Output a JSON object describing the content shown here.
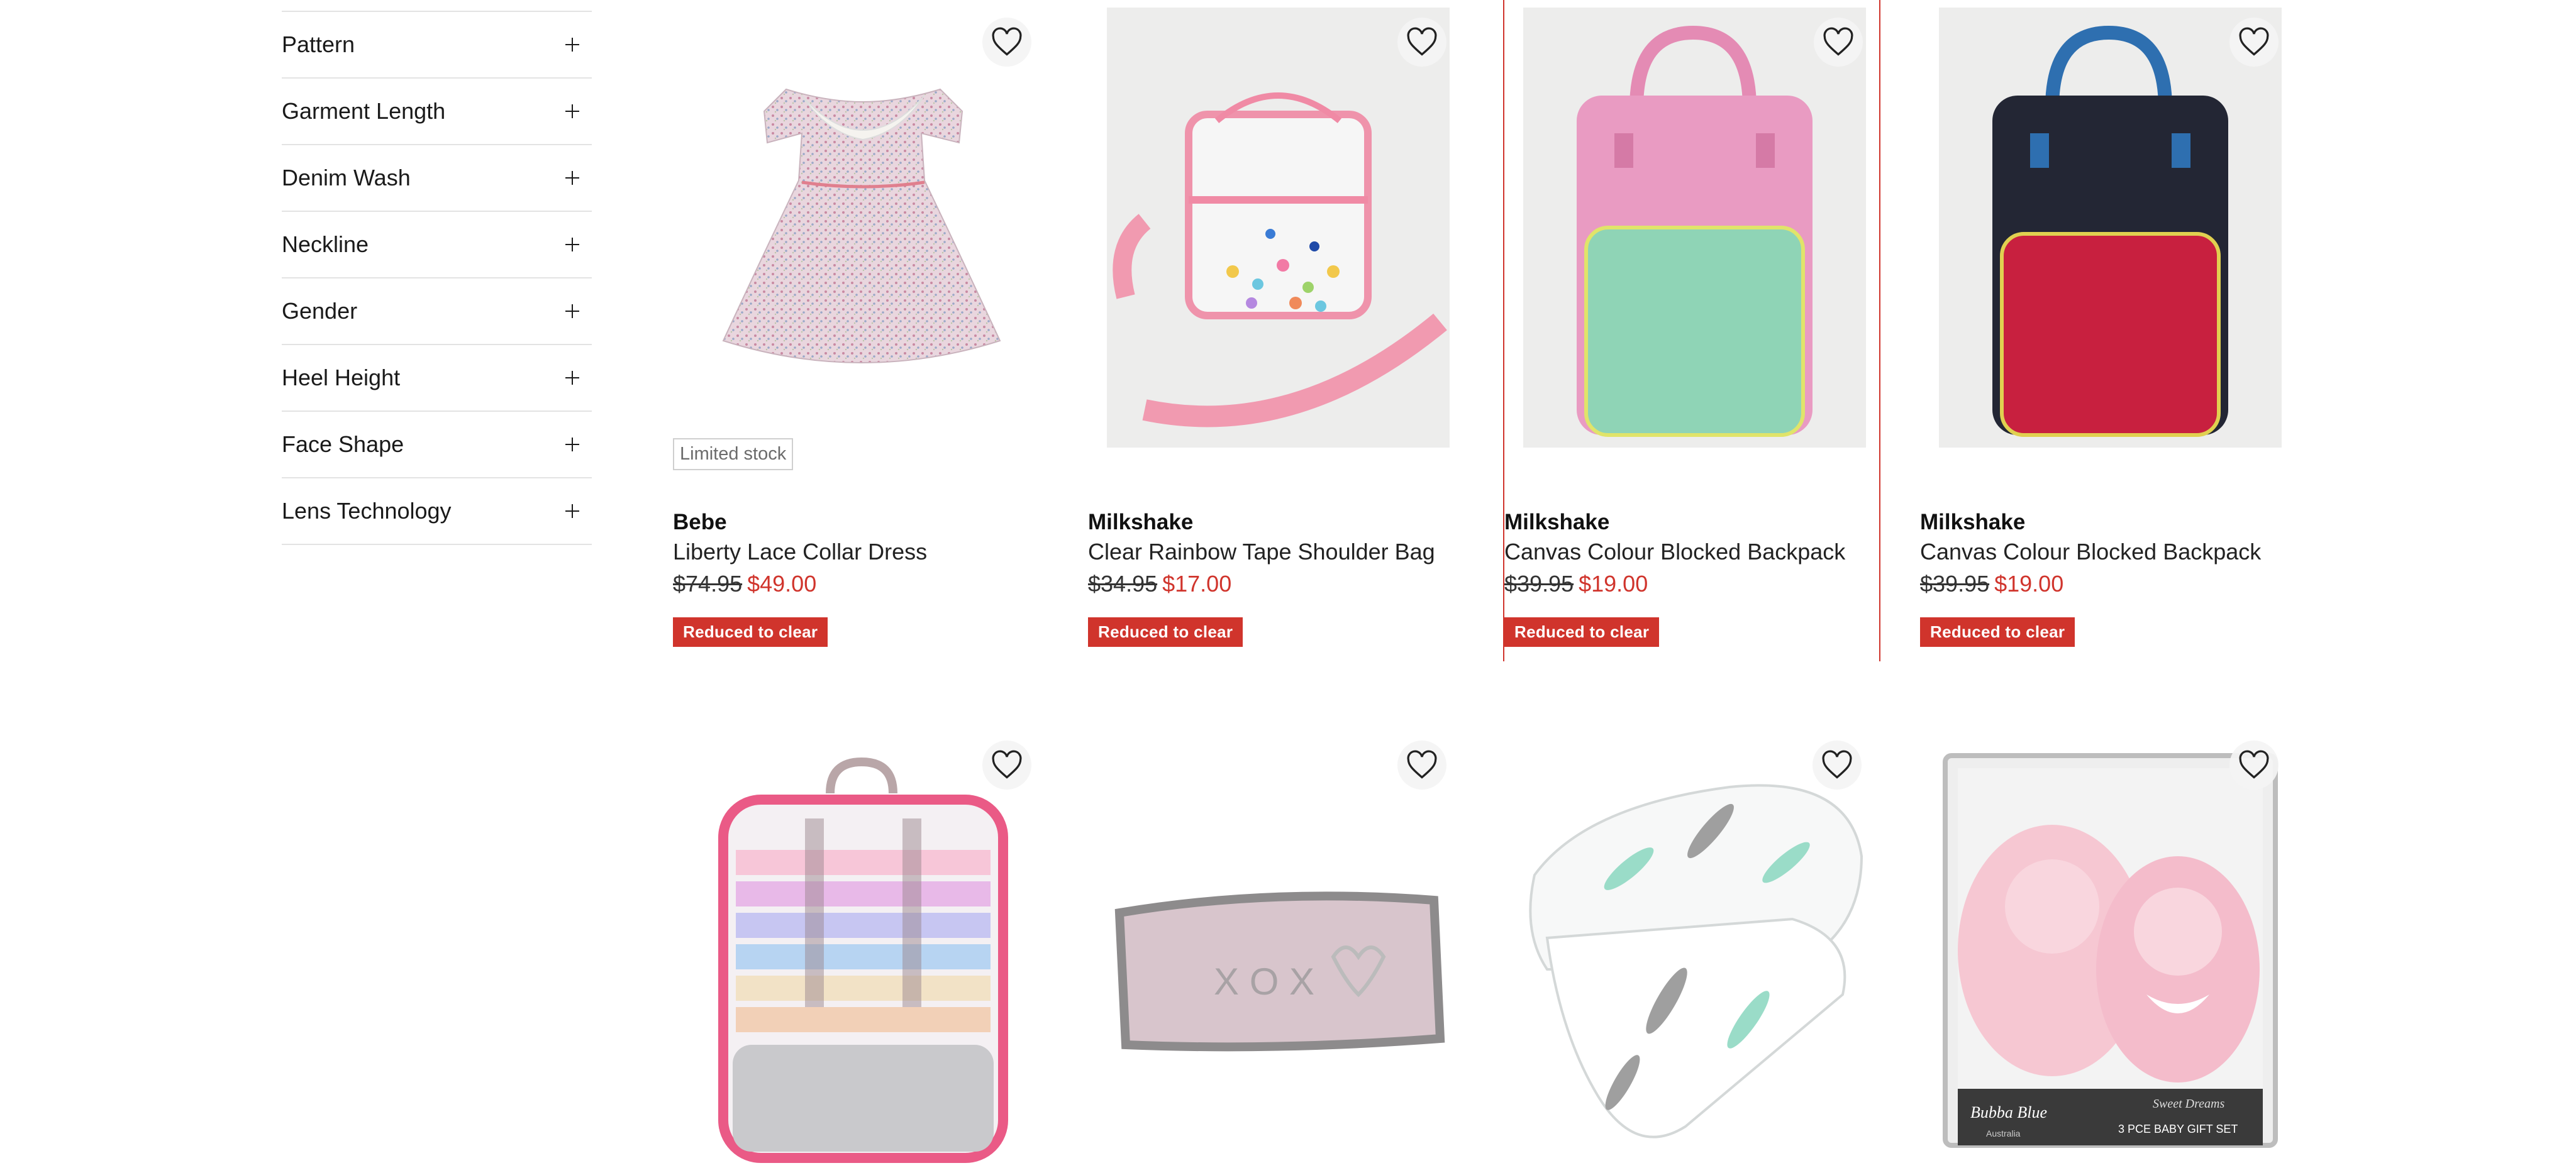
{
  "filters": [
    {
      "label": "Pattern"
    },
    {
      "label": "Garment Length"
    },
    {
      "label": "Denim Wash"
    },
    {
      "label": "Neckline"
    },
    {
      "label": "Gender"
    },
    {
      "label": "Heel Height"
    },
    {
      "label": "Face Shape"
    },
    {
      "label": "Lens Technology"
    }
  ],
  "products": [
    {
      "brand": "Bebe",
      "name": "Liberty Lace Collar Dress",
      "was_price": "$74.95",
      "now_price": "$49.00",
      "badge": "Reduced to clear",
      "stock_tag": "Limited stock",
      "image": "floral-dress"
    },
    {
      "brand": "Milkshake",
      "name": "Clear Rainbow Tape Shoulder Bag",
      "was_price": "$34.95",
      "now_price": "$17.00",
      "badge": "Reduced to clear",
      "image": "clear-shoulder-bag"
    },
    {
      "brand": "Milkshake",
      "name": "Canvas Colour Blocked Backpack",
      "was_price": "$39.95",
      "now_price": "$19.00",
      "badge": "Reduced to clear",
      "image": "pink-backpack"
    },
    {
      "brand": "Milkshake",
      "name": "Canvas Colour Blocked Backpack",
      "was_price": "$39.95",
      "now_price": "$19.00",
      "badge": "Reduced to clear",
      "image": "navy-backpack"
    },
    {
      "image": "clear-rainbow-backpack"
    },
    {
      "image": "pink-knit-blanket"
    },
    {
      "image": "feather-swaddle-wraps"
    },
    {
      "image": "bunny-gift-set",
      "package_text": [
        "Bubba Blue",
        "Australia",
        "Sweet Dreams",
        "3 PCE BABY GIFT SET"
      ]
    }
  ],
  "icons": {
    "wishlist": "heart-outline-icon",
    "expand": "plus-icon"
  },
  "colors": {
    "sale_red": "#d0342c",
    "divider": "#e3e3e3",
    "text": "#1a1a1a"
  }
}
